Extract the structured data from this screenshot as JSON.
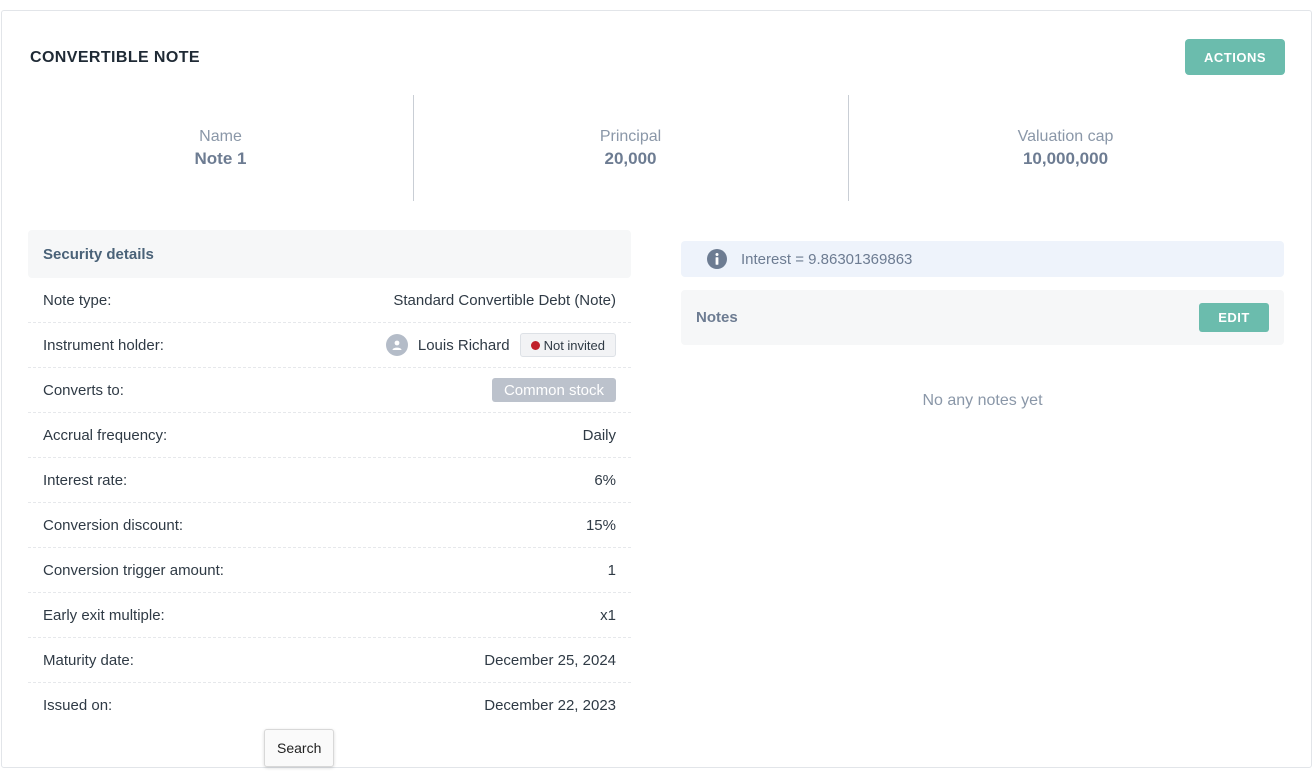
{
  "card": {
    "title": "CONVERTIBLE NOTE",
    "actions_label": "ACTIONS"
  },
  "stats": [
    {
      "label": "Name",
      "value": "Note 1"
    },
    {
      "label": "Principal",
      "value": "20,000"
    },
    {
      "label": "Valuation cap",
      "value": "10,000,000"
    }
  ],
  "details": {
    "title": "Security details",
    "rows": [
      {
        "label": "Note type:",
        "value": "Standard Convertible Debt (Note)"
      },
      {
        "label": "Instrument holder:",
        "holder_name": "Louis Richard",
        "invite_status": "Not invited"
      },
      {
        "label": "Converts to:",
        "value": "Common stock"
      },
      {
        "label": "Accrual frequency:",
        "value": "Daily"
      },
      {
        "label": "Interest rate:",
        "value": "6%"
      },
      {
        "label": "Conversion discount:",
        "value": "15%"
      },
      {
        "label": "Conversion trigger amount:",
        "value": "1"
      },
      {
        "label": "Early exit multiple:",
        "value": "x1"
      },
      {
        "label": "Maturity date:",
        "value": "December 25, 2024"
      },
      {
        "label": "Issued on:",
        "value": "December 22, 2023"
      }
    ]
  },
  "interest": {
    "text": "Interest = 9.86301369863",
    "icon": "info-icon"
  },
  "notes": {
    "title": "Notes",
    "edit_label": "EDIT",
    "empty_text": "No any notes yet"
  },
  "tooltip": {
    "text": "Search"
  },
  "colors": {
    "accent": "#6bbcad",
    "status_not_invited": "#c0202a"
  }
}
